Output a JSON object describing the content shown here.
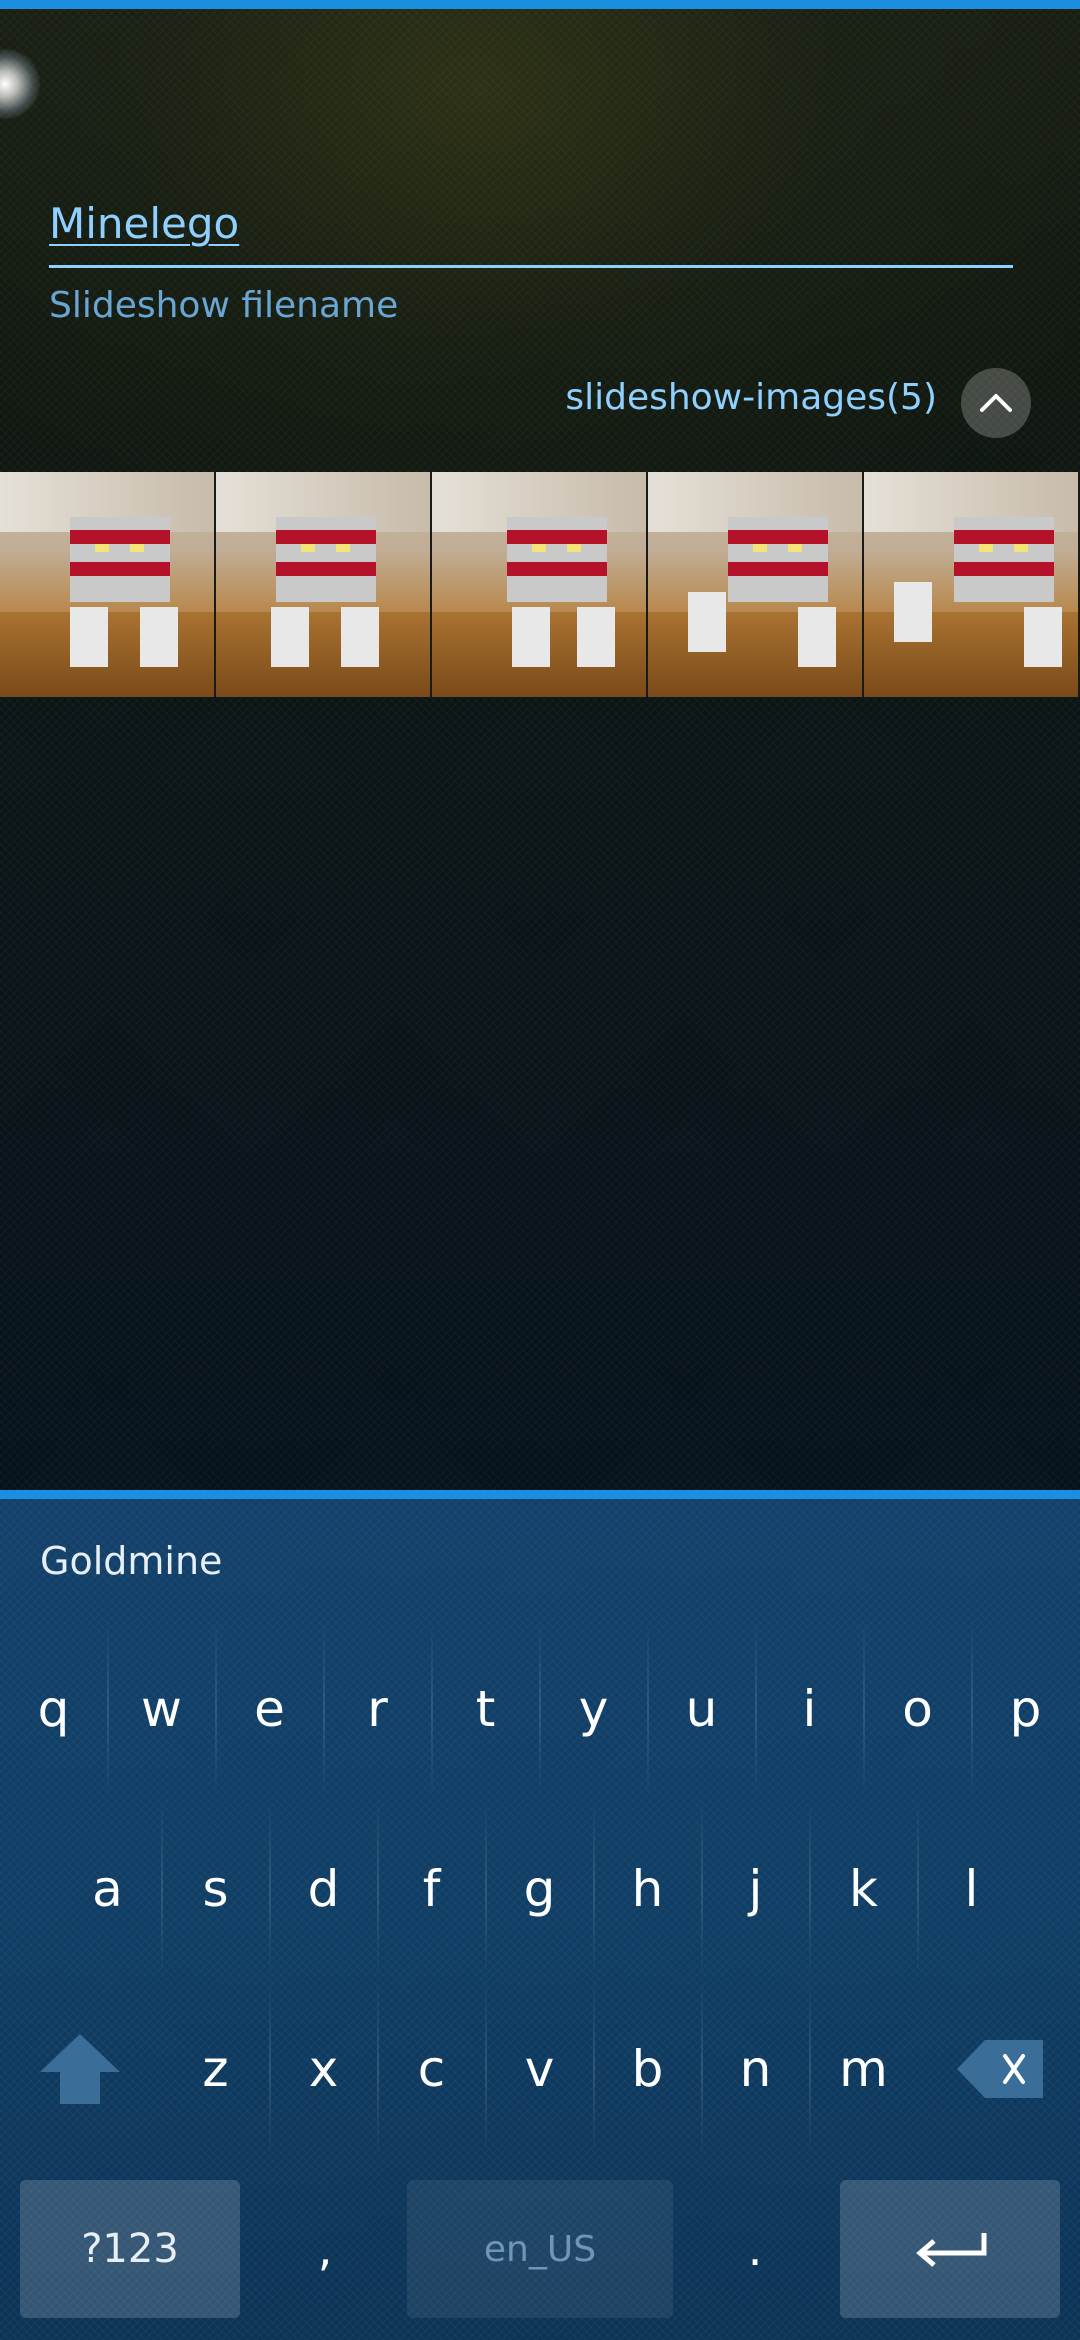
{
  "form": {
    "filename_value": "Minelego",
    "filename_label": "Slideshow filename",
    "images_label": "slideshow-images(5)"
  },
  "thumbnails": [
    {
      "icon": "image-thumbnail"
    },
    {
      "icon": "image-thumbnail"
    },
    {
      "icon": "image-thumbnail"
    },
    {
      "icon": "image-thumbnail"
    },
    {
      "icon": "image-thumbnail"
    }
  ],
  "keyboard": {
    "suggestion": "Goldmine",
    "row1": [
      "q",
      "w",
      "e",
      "r",
      "t",
      "y",
      "u",
      "i",
      "o",
      "p"
    ],
    "row2": [
      "a",
      "s",
      "d",
      "f",
      "g",
      "h",
      "j",
      "k",
      "l"
    ],
    "row3": [
      "z",
      "x",
      "c",
      "v",
      "b",
      "n",
      "m"
    ],
    "symbols_label": "?123",
    "comma": ",",
    "space_label": "en_US",
    "period": "."
  },
  "colors": {
    "accent": "#1a8fe0",
    "text_highlight": "#8fd0ff",
    "keyboard_bg": "#0f3d64"
  }
}
